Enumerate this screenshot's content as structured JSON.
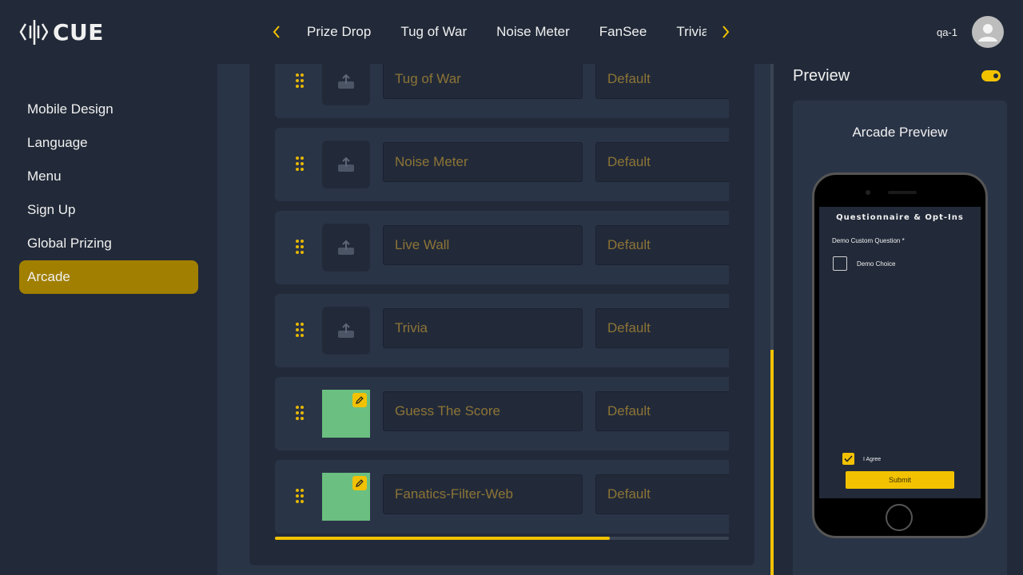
{
  "app": {
    "logo_text": "CUE"
  },
  "tabs": {
    "items": [
      {
        "label": "Prize Drop"
      },
      {
        "label": "Tug of War"
      },
      {
        "label": "Noise Meter"
      },
      {
        "label": "FanSee"
      },
      {
        "label": "Trivia"
      }
    ],
    "prev_icon": "chevron-left-icon",
    "next_icon": "chevron-right-icon"
  },
  "user": {
    "name": "qa-1",
    "avatar_icon": "user-icon"
  },
  "sidebar": {
    "items": [
      {
        "label": "Mobile Design",
        "active": false
      },
      {
        "label": "Language",
        "active": false
      },
      {
        "label": "Menu",
        "active": false
      },
      {
        "label": "Sign Up",
        "active": false
      },
      {
        "label": "Global Prizing",
        "active": false
      },
      {
        "label": "Arcade",
        "active": true
      }
    ]
  },
  "arcade_rows": [
    {
      "name": "Tug of War",
      "type": "Default",
      "has_image": false
    },
    {
      "name": "Noise Meter",
      "type": "Default",
      "has_image": false
    },
    {
      "name": "Live Wall",
      "type": "Default",
      "has_image": false
    },
    {
      "name": "Trivia",
      "type": "Default",
      "has_image": false
    },
    {
      "name": "Guess The Score",
      "type": "Default",
      "has_image": true
    },
    {
      "name": "Fanatics-Filter-Web",
      "type": "Default",
      "has_image": true
    }
  ],
  "preview": {
    "title": "Preview",
    "toggle_on": true,
    "card_title": "Arcade Preview",
    "screen": {
      "heading": "Questionnaire & Opt-Ins",
      "question": "Demo Custom Question *",
      "choice": "Demo Choice",
      "agree_label": "I Agree",
      "agree_checked": true,
      "submit_label": "Submit"
    }
  },
  "colors": {
    "accent": "#f2c200",
    "active_nav": "#a17f00",
    "background": "#222a39",
    "panel": "#2a3447",
    "placeholder_text": "#8d7436",
    "image_thumb": "#6bbf80"
  }
}
